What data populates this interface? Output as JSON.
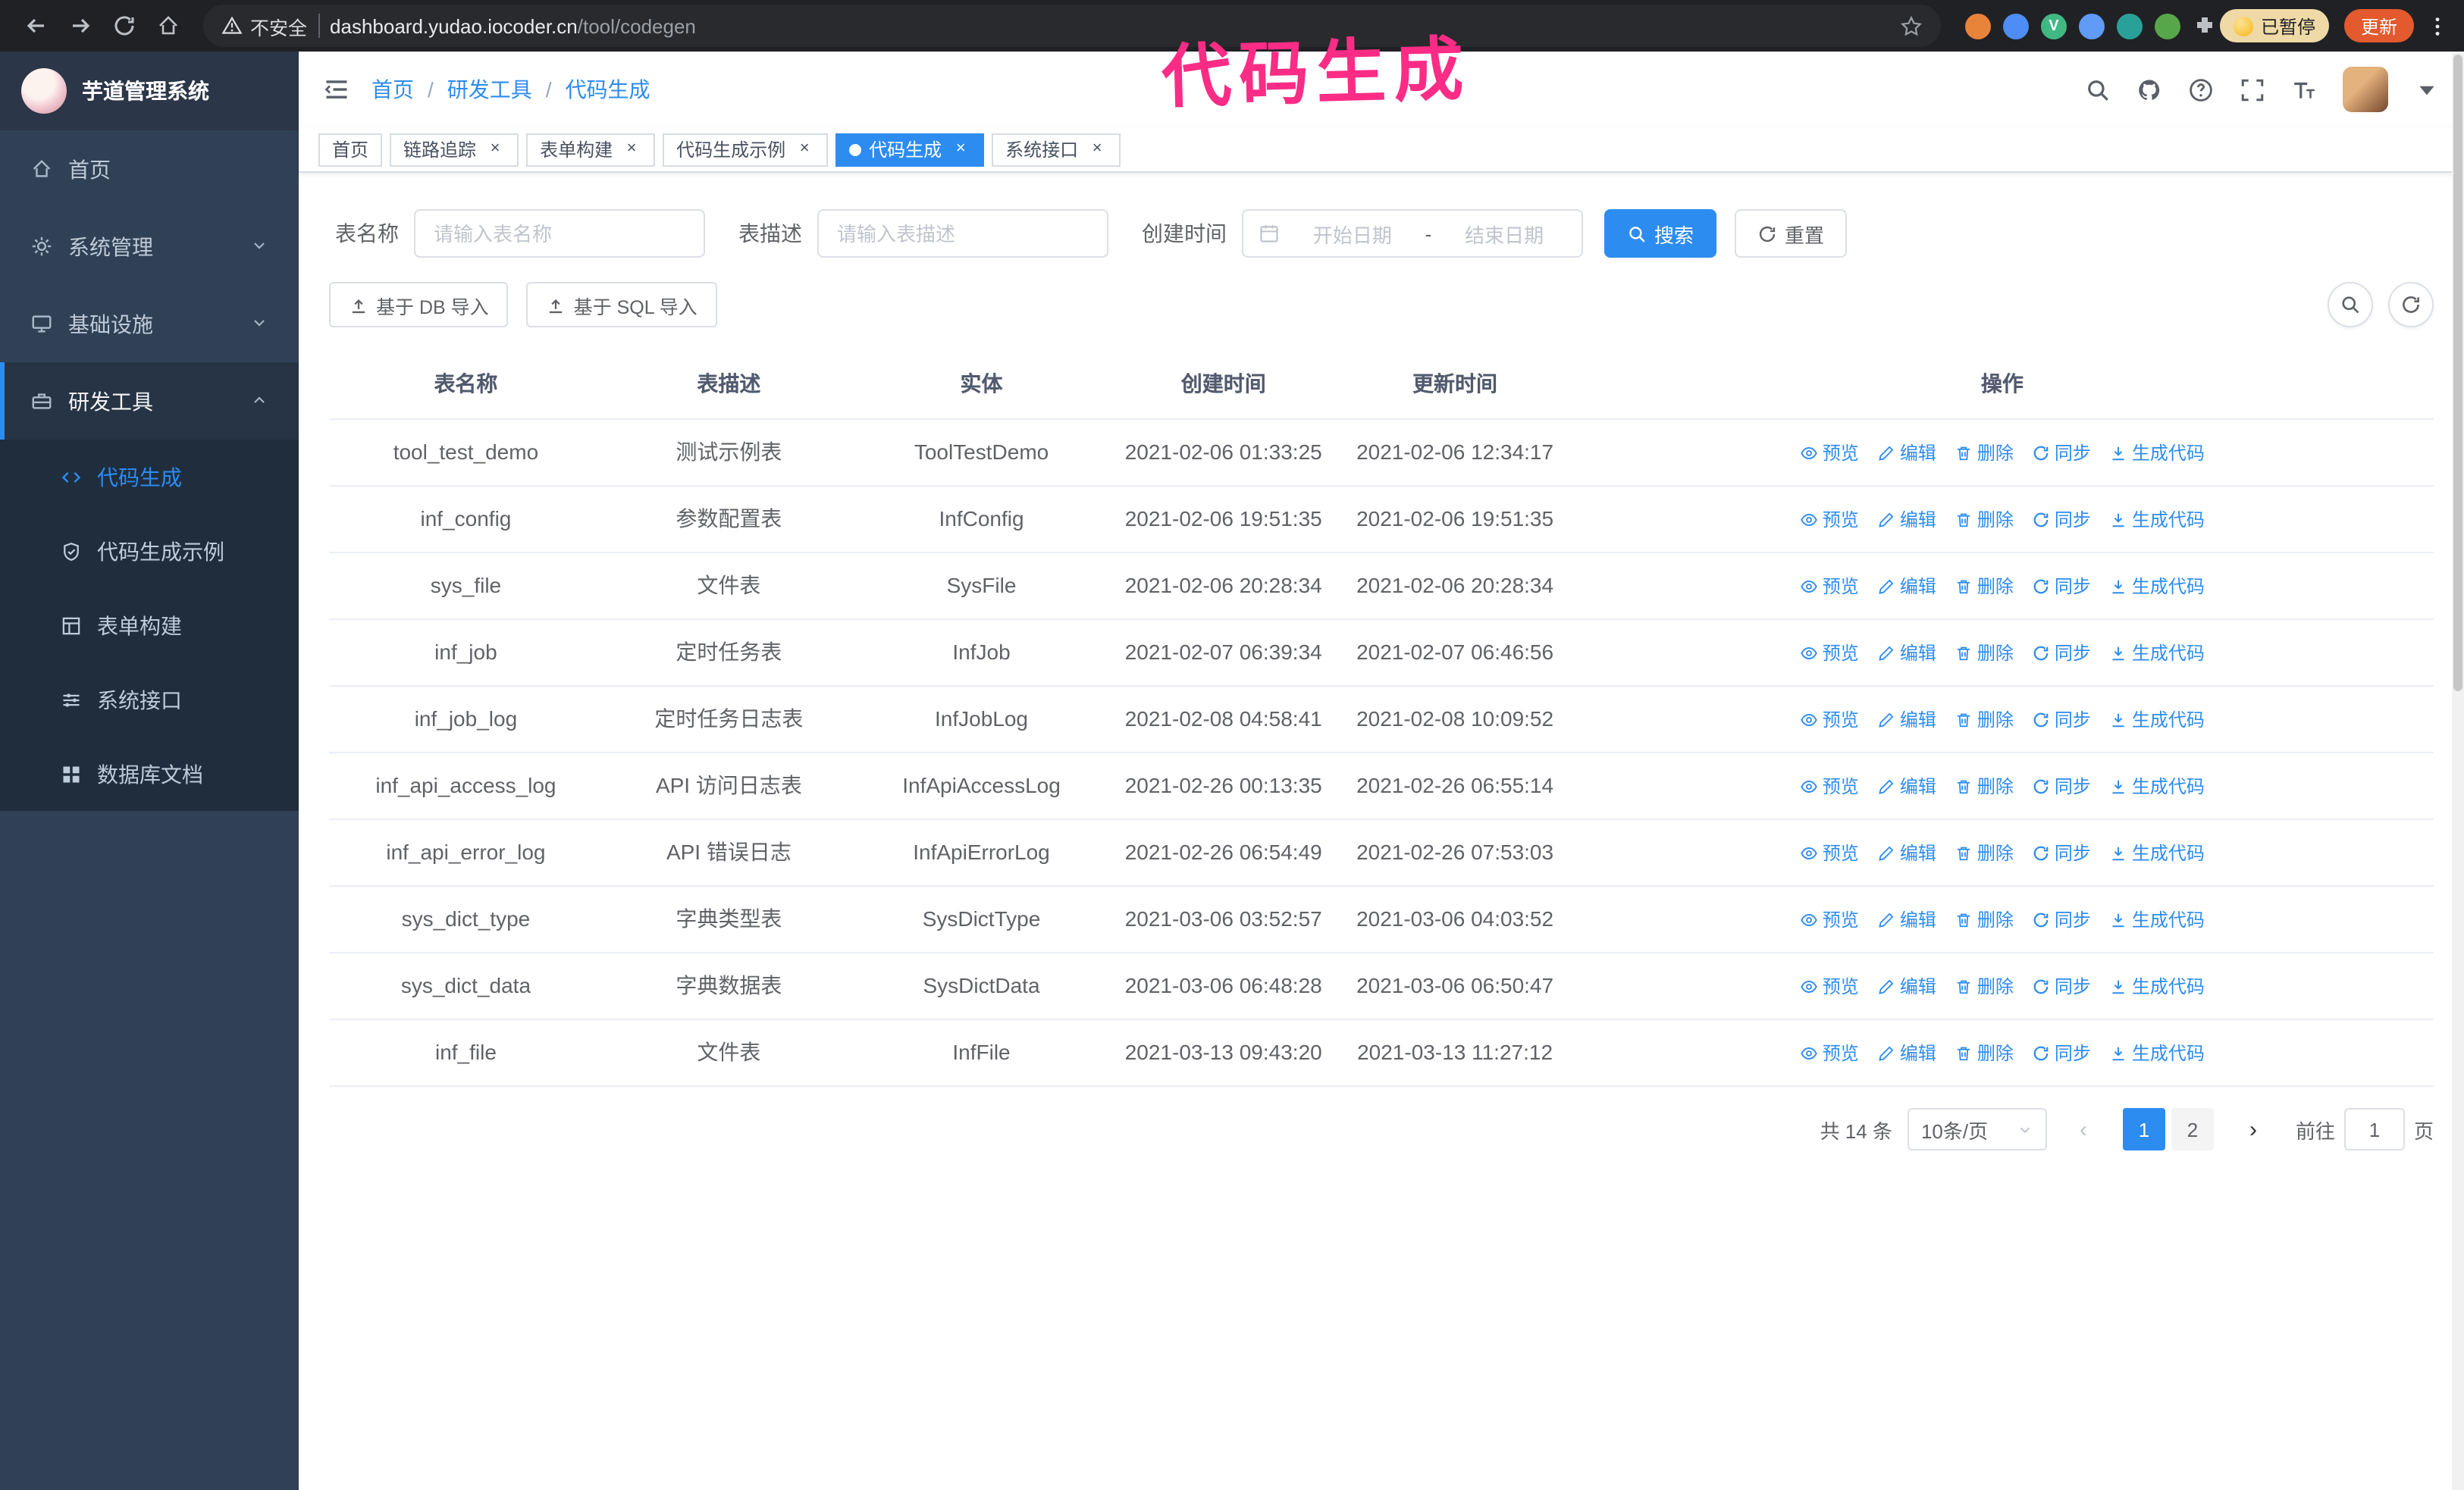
{
  "colors": {
    "accent": "#2d8cf0",
    "sidebar_bg": "#304156",
    "submenu_bg": "#1f2d3d",
    "chrome_bg": "#202124",
    "update_btn": "#e25a2e",
    "annotation": "#fb2c86"
  },
  "annotation": {
    "text": "代码生成"
  },
  "browser": {
    "security_label": "不安全",
    "url_host": "dashboard.yudao.iocoder.cn",
    "url_path": "/tool/codegen",
    "paused_badge": "已暂停",
    "update_button": "更新",
    "extensions": [
      {
        "icon": "ext-orange",
        "color": "#e8833a",
        "glyph": ""
      },
      {
        "icon": "ext-blue-drop",
        "color": "#4e8df5",
        "glyph": ""
      },
      {
        "icon": "ext-vue",
        "color": "#41b883",
        "glyph": "V"
      },
      {
        "icon": "ext-grid",
        "color": "#5f9bf7",
        "glyph": ""
      },
      {
        "icon": "ext-teal",
        "color": "#2aa198",
        "glyph": ""
      },
      {
        "icon": "ext-green",
        "color": "#57a64a",
        "glyph": ""
      }
    ]
  },
  "sidebar": {
    "logo_title": "芋道管理系统",
    "items": [
      {
        "label": "首页",
        "icon": "home"
      },
      {
        "label": "系统管理",
        "icon": "gear",
        "chevron": "down"
      },
      {
        "label": "基础设施",
        "icon": "monitor",
        "chevron": "down"
      },
      {
        "label": "研发工具",
        "icon": "tools",
        "chevron": "up",
        "expanded": true,
        "children": [
          {
            "label": "代码生成",
            "icon": "code",
            "active": true
          },
          {
            "label": "代码生成示例",
            "icon": "shield"
          },
          {
            "label": "表单构建",
            "icon": "form"
          },
          {
            "label": "系统接口",
            "icon": "api"
          },
          {
            "label": "数据库文档",
            "icon": "grid"
          }
        ]
      }
    ]
  },
  "header": {
    "breadcrumb": [
      "首页",
      "研发工具",
      "代码生成"
    ],
    "breadcrumb_separator": "/"
  },
  "tabs": [
    {
      "label": "首页",
      "closable": false,
      "active": false
    },
    {
      "label": "链路追踪",
      "closable": true,
      "active": false
    },
    {
      "label": "表单构建",
      "closable": true,
      "active": false
    },
    {
      "label": "代码生成示例",
      "closable": true,
      "active": false
    },
    {
      "label": "代码生成",
      "closable": true,
      "active": true
    },
    {
      "label": "系统接口",
      "closable": true,
      "active": false
    }
  ],
  "filters": {
    "table_name_label": "表名称",
    "table_name_placeholder": "请输入表名称",
    "table_desc_label": "表描述",
    "table_desc_placeholder": "请输入表描述",
    "create_time_label": "创建时间",
    "start_date_placeholder": "开始日期",
    "range_separator": "-",
    "end_date_placeholder": "结束日期",
    "search_button": "搜索",
    "reset_button": "重置"
  },
  "toolbar": {
    "import_db_button": "基于 DB 导入",
    "import_sql_button": "基于 SQL 导入"
  },
  "table": {
    "columns": [
      "表名称",
      "表描述",
      "实体",
      "创建时间",
      "更新时间",
      "操作"
    ],
    "actions": [
      {
        "label": "预览",
        "icon": "eye"
      },
      {
        "label": "编辑",
        "icon": "edit"
      },
      {
        "label": "删除",
        "icon": "trash"
      },
      {
        "label": "同步",
        "icon": "refresh"
      },
      {
        "label": "生成代码",
        "icon": "download"
      }
    ],
    "rows": [
      {
        "name": "tool_test_demo",
        "desc": "测试示例表",
        "entity": "ToolTestDemo",
        "created": "2021-02-06 01:33:25",
        "updated": "2021-02-06 12:34:17"
      },
      {
        "name": "inf_config",
        "desc": "参数配置表",
        "entity": "InfConfig",
        "created": "2021-02-06 19:51:35",
        "updated": "2021-02-06 19:51:35"
      },
      {
        "name": "sys_file",
        "desc": "文件表",
        "entity": "SysFile",
        "created": "2021-02-06 20:28:34",
        "updated": "2021-02-06 20:28:34"
      },
      {
        "name": "inf_job",
        "desc": "定时任务表",
        "entity": "InfJob",
        "created": "2021-02-07 06:39:34",
        "updated": "2021-02-07 06:46:56"
      },
      {
        "name": "inf_job_log",
        "desc": "定时任务日志表",
        "entity": "InfJobLog",
        "created": "2021-02-08 04:58:41",
        "updated": "2021-02-08 10:09:52"
      },
      {
        "name": "inf_api_access_log",
        "desc": "API 访问日志表",
        "entity": "InfApiAccessLog",
        "created": "2021-02-26 00:13:35",
        "updated": "2021-02-26 06:55:14"
      },
      {
        "name": "inf_api_error_log",
        "desc": "API 错误日志",
        "entity": "InfApiErrorLog",
        "created": "2021-02-26 06:54:49",
        "updated": "2021-02-26 07:53:03"
      },
      {
        "name": "sys_dict_type",
        "desc": "字典类型表",
        "entity": "SysDictType",
        "created": "2021-03-06 03:52:57",
        "updated": "2021-03-06 04:03:52"
      },
      {
        "name": "sys_dict_data",
        "desc": "字典数据表",
        "entity": "SysDictData",
        "created": "2021-03-06 06:48:28",
        "updated": "2021-03-06 06:50:47"
      },
      {
        "name": "inf_file",
        "desc": "文件表",
        "entity": "InfFile",
        "created": "2021-03-13 09:43:20",
        "updated": "2021-03-13 11:27:12"
      }
    ]
  },
  "pagination": {
    "total": "共 14 条",
    "page_size": "10条/页",
    "pages": [
      "1",
      "2"
    ],
    "active_page": "1",
    "goto_label": "前往",
    "goto_value": "1",
    "goto_suffix": "页"
  }
}
